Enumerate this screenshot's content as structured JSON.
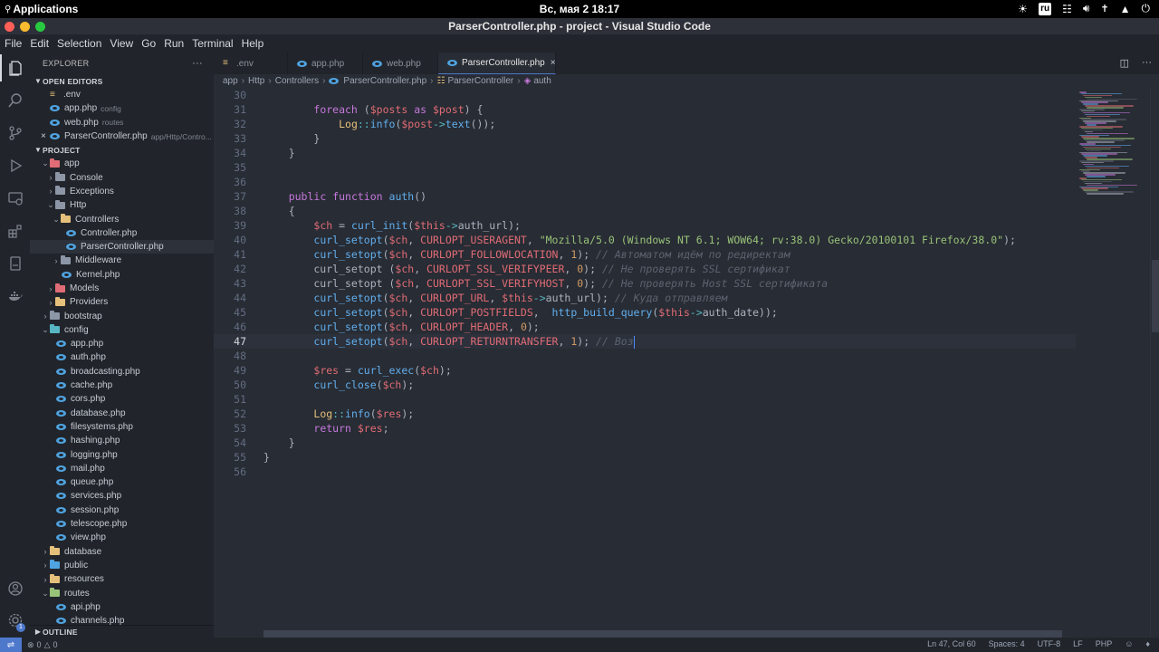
{
  "topbar": {
    "applications": "Applications",
    "clock": "Вс, мая  2   18:17",
    "keyboard_layout": "ru"
  },
  "window": {
    "title": "ParserController.php - project - Visual Studio Code",
    "buttons": [
      "#ff5f57",
      "#febc2e",
      "#28c840"
    ]
  },
  "menu": [
    "File",
    "Edit",
    "Selection",
    "View",
    "Go",
    "Run",
    "Terminal",
    "Help"
  ],
  "activity": {
    "items": [
      "files-icon",
      "search-icon",
      "source-control-icon",
      "run-debug-icon",
      "remote-explorer-icon",
      "extensions-icon",
      "testing-icon",
      "docker-icon"
    ],
    "bottom": [
      "account-icon",
      "settings-gear-icon"
    ],
    "settings_badge": "1"
  },
  "sidebar": {
    "header": "EXPLORER",
    "more": "···",
    "open_editors_title": "OPEN EDITORS",
    "open_editors": [
      {
        "name": ".env",
        "desc": ""
      },
      {
        "name": "app.php",
        "desc": "config"
      },
      {
        "name": "web.php",
        "desc": "routes"
      },
      {
        "name": "ParserController.php",
        "desc": "app/Http/Contro..."
      }
    ],
    "project_title": "PROJECT",
    "tree": [
      {
        "name": "app"
      },
      {
        "name": "Console"
      },
      {
        "name": "Exceptions"
      },
      {
        "name": "Http"
      },
      {
        "name": "Controllers"
      },
      {
        "name": "Controller.php"
      },
      {
        "name": "ParserController.php"
      },
      {
        "name": "Middleware"
      },
      {
        "name": "Kernel.php"
      },
      {
        "name": "Models"
      },
      {
        "name": "Providers"
      },
      {
        "name": "bootstrap"
      },
      {
        "name": "config"
      },
      {
        "name": "app.php"
      },
      {
        "name": "auth.php"
      },
      {
        "name": "broadcasting.php"
      },
      {
        "name": "cache.php"
      },
      {
        "name": "cors.php"
      },
      {
        "name": "database.php"
      },
      {
        "name": "filesystems.php"
      },
      {
        "name": "hashing.php"
      },
      {
        "name": "logging.php"
      },
      {
        "name": "mail.php"
      },
      {
        "name": "queue.php"
      },
      {
        "name": "services.php"
      },
      {
        "name": "session.php"
      },
      {
        "name": "telescope.php"
      },
      {
        "name": "view.php"
      },
      {
        "name": "database"
      },
      {
        "name": "public"
      },
      {
        "name": "resources"
      },
      {
        "name": "routes"
      },
      {
        "name": "api.php"
      },
      {
        "name": "channels.php"
      }
    ],
    "outline_title": "OUTLINE"
  },
  "tabs": [
    {
      "label": ".env"
    },
    {
      "label": "app.php"
    },
    {
      "label": "web.php"
    },
    {
      "label": "ParserController.php"
    }
  ],
  "breadcrumb": [
    "app",
    "Http",
    "Controllers",
    "ParserController.php",
    "ParserController",
    "auth"
  ],
  "editor": {
    "lines": [
      {
        "n": "30",
        "text": ""
      },
      {
        "n": "31",
        "text": "        foreach ($posts as $post) {"
      },
      {
        "n": "32",
        "text": "            Log::info($post->text());"
      },
      {
        "n": "33",
        "text": "        }"
      },
      {
        "n": "34",
        "text": "    }"
      },
      {
        "n": "35",
        "text": ""
      },
      {
        "n": "36",
        "text": ""
      },
      {
        "n": "37",
        "text": "    public function auth()"
      },
      {
        "n": "38",
        "text": "    {"
      },
      {
        "n": "39",
        "text": "        $ch = curl_init($this->auth_url);"
      },
      {
        "n": "40",
        "text": "        curl_setopt($ch, CURLOPT_USERAGENT, \"Mozilla/5.0 (Windows NT 6.1; WOW64; rv:38.0) Gecko/20100101 Firefox/38.0\");"
      },
      {
        "n": "41",
        "text": "        curl_setopt($ch, CURLOPT_FOLLOWLOCATION, 1); // Автоматом идём по редиректам"
      },
      {
        "n": "42",
        "text": "        curl_setopt ($ch, CURLOPT_SSL_VERIFYPEER, 0); // Не проверять SSL сертификат"
      },
      {
        "n": "43",
        "text": "        curl_setopt ($ch, CURLOPT_SSL_VERIFYHOST, 0); // Не проверять Host SSL сертификата"
      },
      {
        "n": "44",
        "text": "        curl_setopt($ch, CURLOPT_URL, $this->auth_url); // Куда отправляем"
      },
      {
        "n": "45",
        "text": "        curl_setopt($ch, CURLOPT_POSTFIELDS,  http_build_query($this->auth_date));"
      },
      {
        "n": "46",
        "text": "        curl_setopt($ch, CURLOPT_HEADER, 0);"
      },
      {
        "n": "47",
        "text": "        curl_setopt($ch, CURLOPT_RETURNTRANSFER, 1); // Воз"
      },
      {
        "n": "48",
        "text": ""
      },
      {
        "n": "49",
        "text": "        $res = curl_exec($ch);"
      },
      {
        "n": "50",
        "text": "        curl_close($ch);"
      },
      {
        "n": "51",
        "text": ""
      },
      {
        "n": "52",
        "text": "        Log::info($res);"
      },
      {
        "n": "53",
        "text": "        return $res;"
      },
      {
        "n": "54",
        "text": "    }"
      },
      {
        "n": "55",
        "text": "}"
      },
      {
        "n": "56",
        "text": ""
      }
    ],
    "current_line": "47"
  },
  "status": {
    "problems_errors": "0",
    "problems_warnings": "0",
    "position": "Ln 47, Col 60",
    "spaces": "Spaces: 4",
    "encoding": "UTF-8",
    "eol": "LF",
    "language": "PHP"
  },
  "colors": {
    "accent": "#4d78cc",
    "keyword": "#c678dd",
    "function": "#61afef",
    "variable": "#e06c75",
    "string": "#98c379",
    "number": "#d19a66",
    "comment": "#5c6370"
  }
}
